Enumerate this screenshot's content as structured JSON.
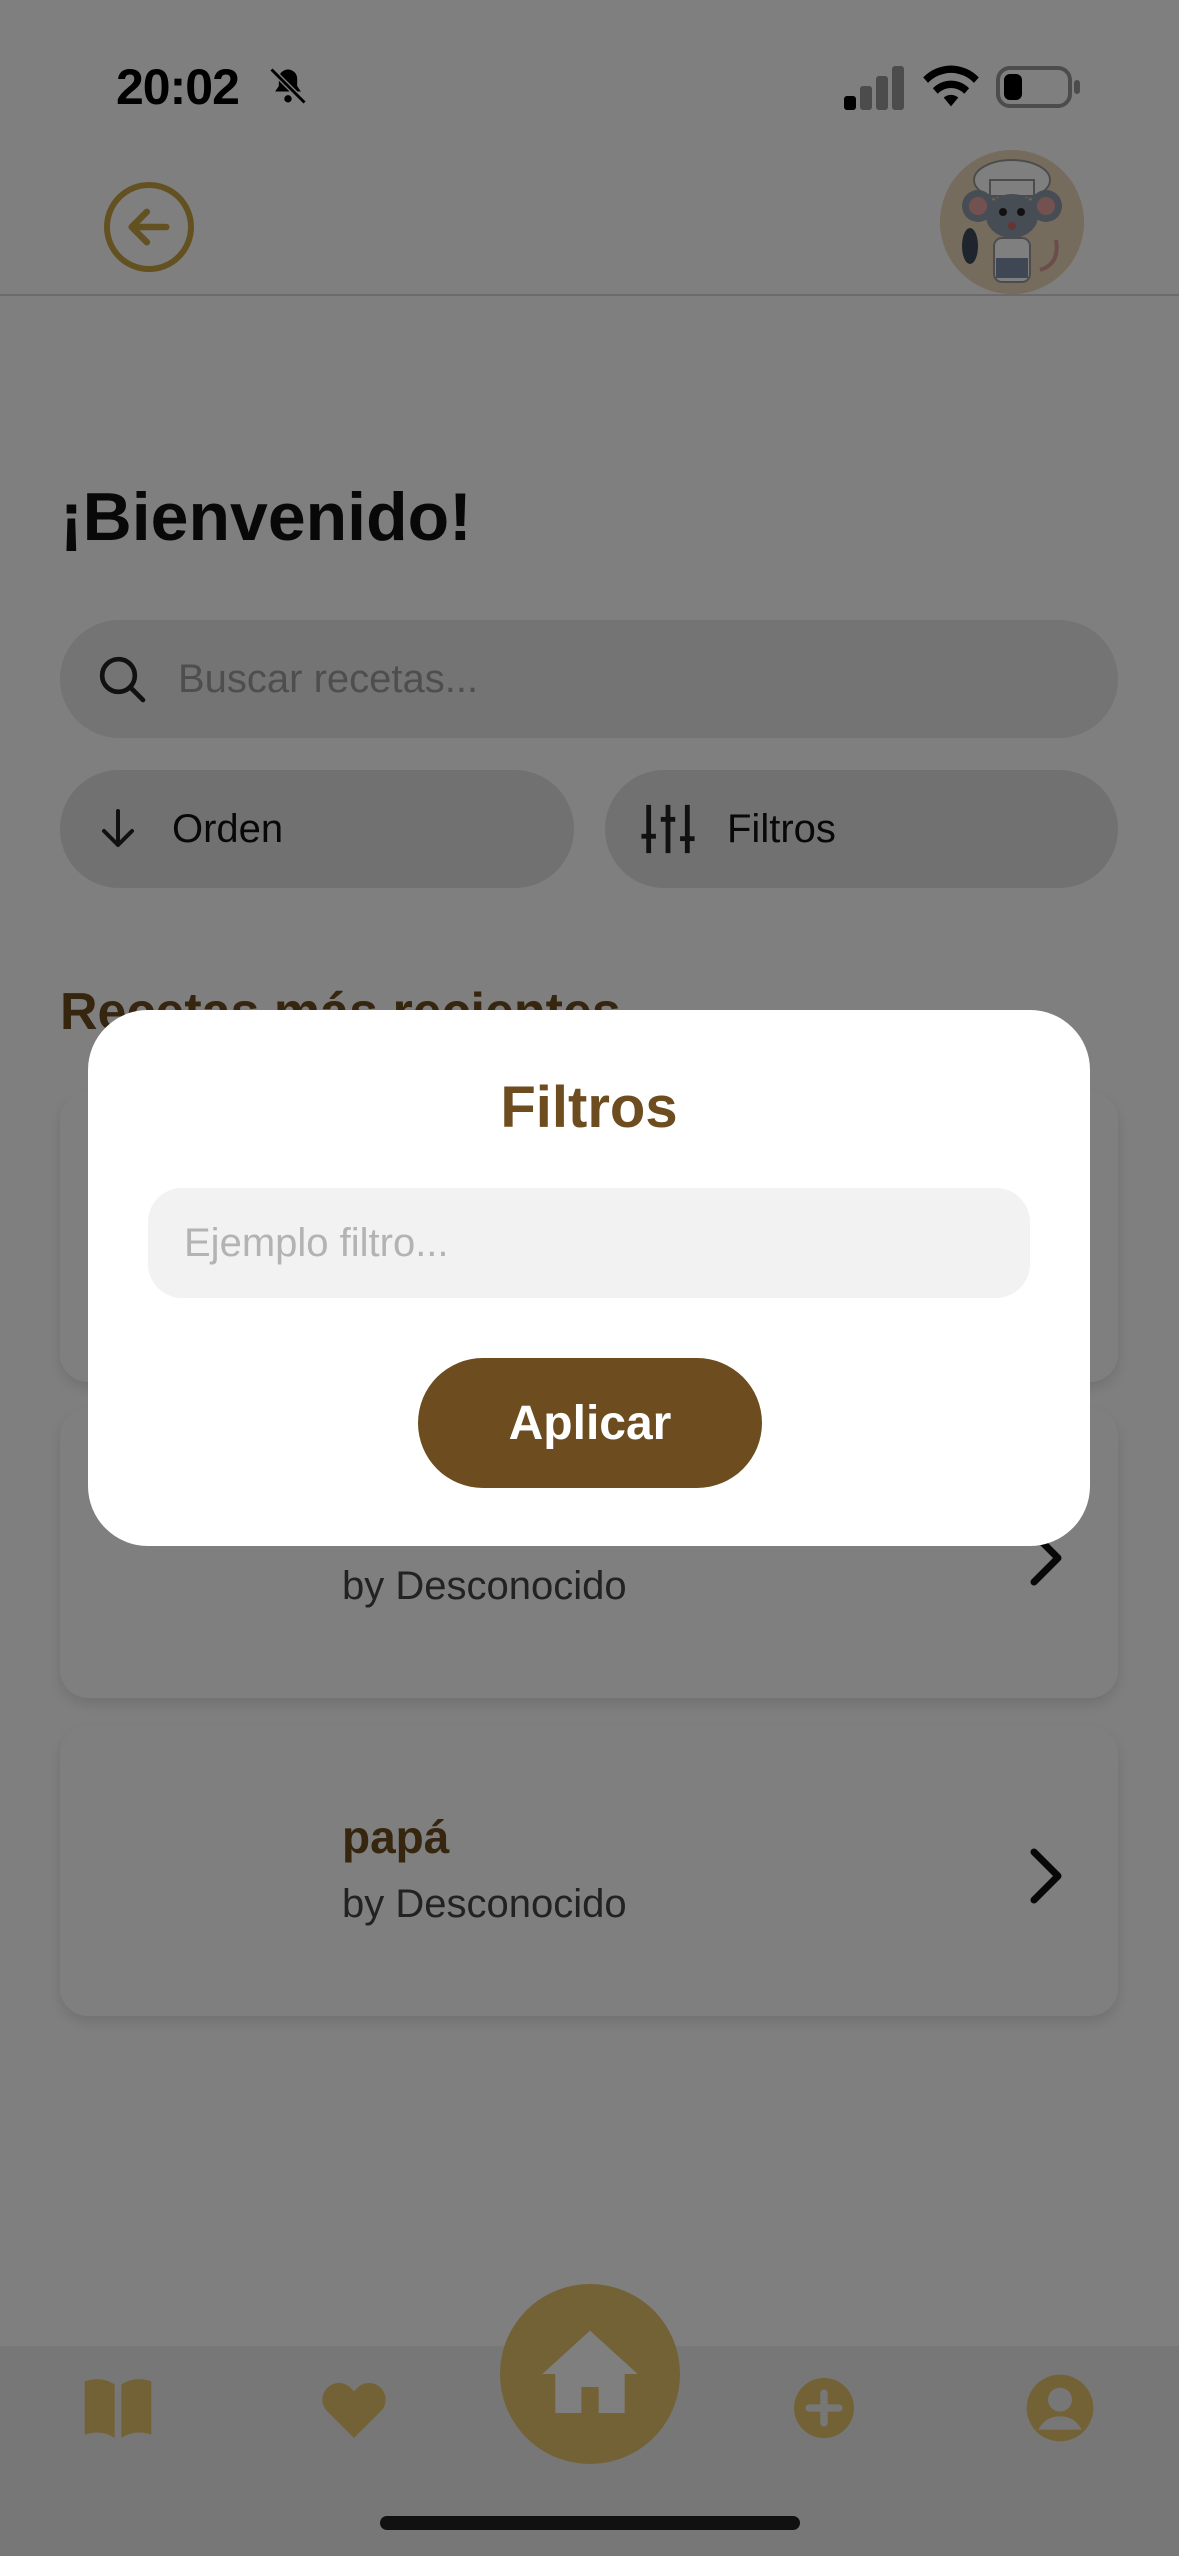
{
  "status_bar": {
    "time": "20:02"
  },
  "header": {
    "back_icon": "arrow-left-circle-icon",
    "avatar": "chef-rat-avatar"
  },
  "main": {
    "welcome": "¡Bienvenido!",
    "search": {
      "placeholder": "Buscar recetas..."
    },
    "sort_label": "Orden",
    "filters_label": "Filtros",
    "section_title": "Recetas más recientes",
    "recipes": [
      {
        "title": "",
        "author": ""
      },
      {
        "title": "",
        "author": "by Desconocido"
      },
      {
        "title": "papá",
        "author": "by Desconocido"
      }
    ]
  },
  "modal": {
    "title": "Filtros",
    "input_placeholder": "Ejemplo filtro...",
    "apply_label": "Aplicar"
  },
  "tabbar": {
    "items": [
      "book-icon",
      "heart-icon",
      "home-icon",
      "plus-circle-icon",
      "user-circle-icon"
    ]
  },
  "colors": {
    "brand_brown": "#6d4c1f",
    "accent_gold": "#e7c46b",
    "back_gold": "#c9a245"
  }
}
